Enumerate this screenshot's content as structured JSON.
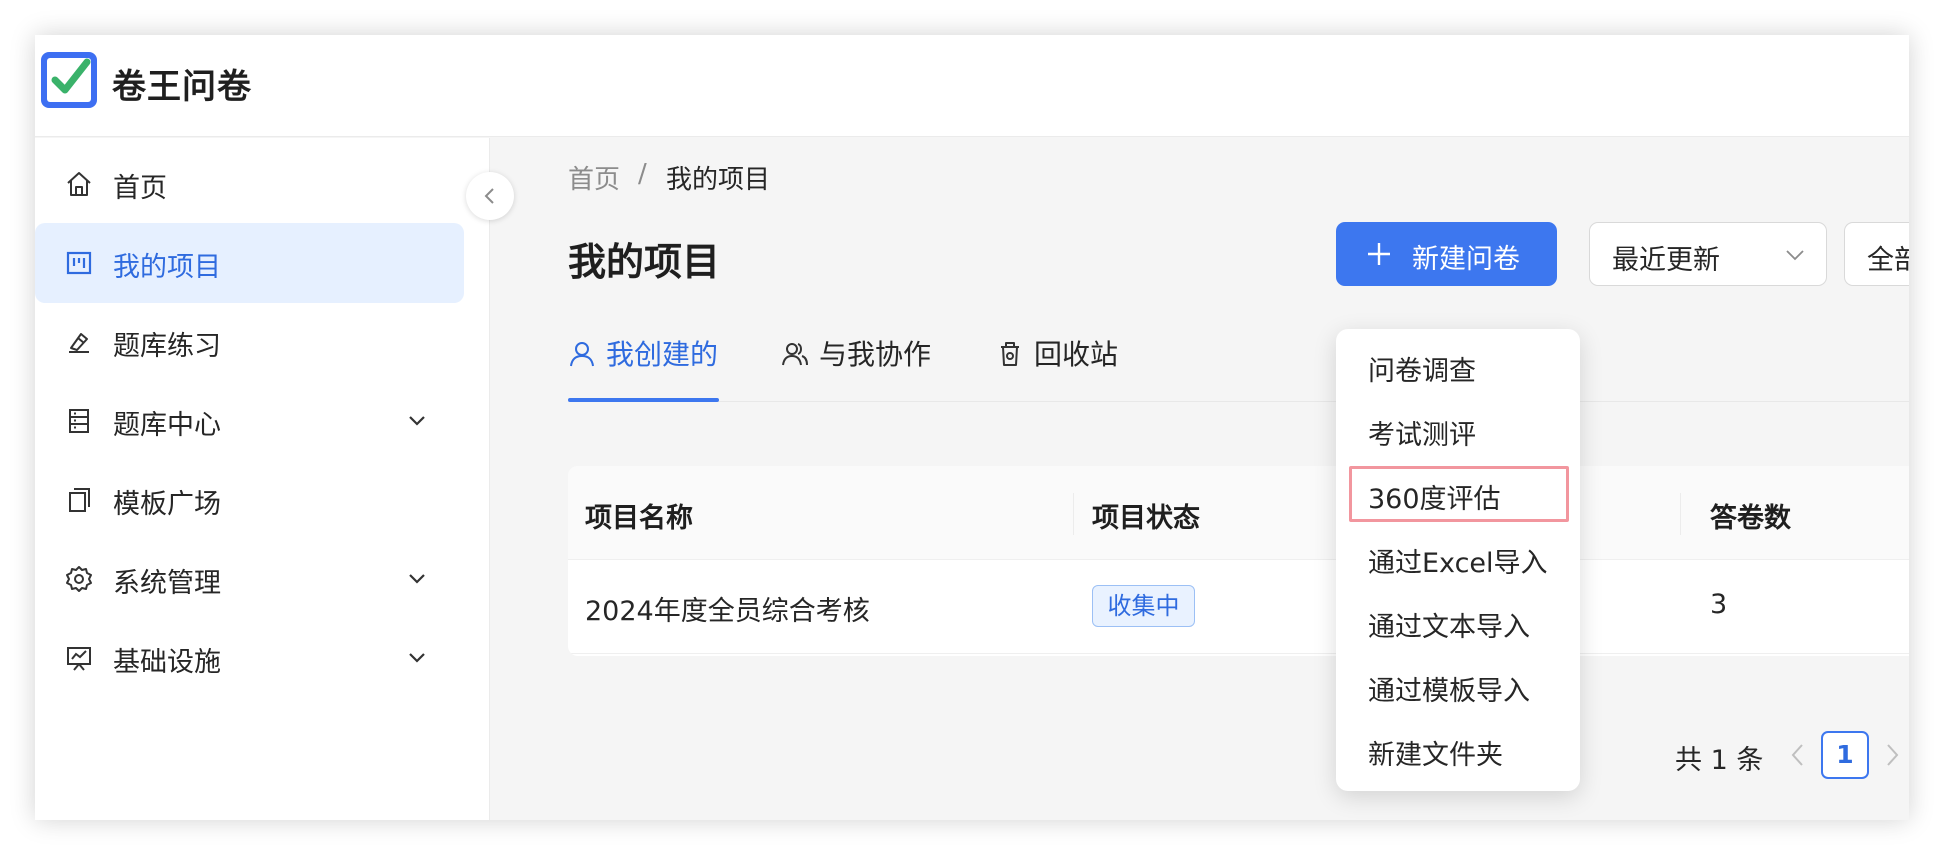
{
  "app": {
    "title": "卷王问卷"
  },
  "sidebar": {
    "items": [
      {
        "label": "首页",
        "icon": "home-icon"
      },
      {
        "label": "我的项目",
        "icon": "project-icon",
        "active": true
      },
      {
        "label": "题库练习",
        "icon": "pen-icon"
      },
      {
        "label": "题库中心",
        "icon": "library-icon",
        "expandable": true
      },
      {
        "label": "模板广场",
        "icon": "template-icon"
      },
      {
        "label": "系统管理",
        "icon": "gear-icon",
        "expandable": true
      },
      {
        "label": "基础设施",
        "icon": "infrastructure-icon",
        "expandable": true
      }
    ]
  },
  "breadcrumb": {
    "home": "首页",
    "separator": "/",
    "current": "我的项目"
  },
  "header": {
    "title": "我的项目",
    "new_button": "新建问卷",
    "sort_select": "最近更新",
    "filter_select": "全部"
  },
  "tabs": [
    {
      "label": "我创建的",
      "icon": "user-icon",
      "active": true
    },
    {
      "label": "与我协作",
      "icon": "users-icon"
    },
    {
      "label": "回收站",
      "icon": "trash-icon"
    }
  ],
  "table": {
    "columns": [
      "项目名称",
      "项目状态",
      "答卷数"
    ],
    "rows": [
      {
        "name": "2024年度全员综合考核",
        "status": "收集中",
        "answers": "3"
      }
    ]
  },
  "pagination": {
    "total": "共 1 条",
    "current_page": "1"
  },
  "dropdown": {
    "items": [
      "问卷调查",
      "考试测评",
      "360度评估",
      "通过Excel导入",
      "通过文本导入",
      "通过模板导入",
      "新建文件夹"
    ],
    "highlighted": "360度评估"
  },
  "colors": {
    "primary": "#3d77ef",
    "active_bg": "#e6f0ff",
    "highlight_border": "#f2969e",
    "logo_check": "#3ab26a"
  }
}
